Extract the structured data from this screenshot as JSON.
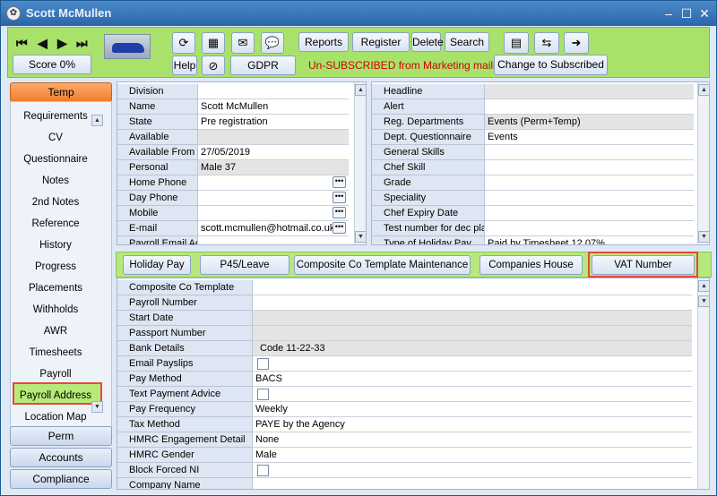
{
  "window": {
    "title": "Scott McMullen"
  },
  "toolbar": {
    "score": "Score 0%",
    "reports": "Reports",
    "register": "Register",
    "delete": "Delete",
    "search": "Search",
    "help": "Help",
    "gdpr": "GDPR",
    "unsubscribed": "Un-SUBSCRIBED from Marketing mailings",
    "change_sub": "Change to Subscribed"
  },
  "sidebar": {
    "temp": "Temp",
    "perm": "Perm",
    "accounts": "Accounts",
    "compliance": "Compliance",
    "items": [
      "Requirements",
      "CV",
      "Questionnaire",
      "Notes",
      "2nd Notes",
      "Reference",
      "History",
      "Progress",
      "Placements",
      "Withholds",
      "AWR",
      "Timesheets",
      "Payroll",
      "Payroll Address",
      "Location Map"
    ]
  },
  "left_panel": {
    "rows": [
      {
        "label": "Division",
        "value": ""
      },
      {
        "label": "Name",
        "value": "Scott McMullen"
      },
      {
        "label": "State",
        "value": "Pre registration"
      },
      {
        "label": "Available",
        "value": ""
      },
      {
        "label": "Available From",
        "value": "27/05/2019"
      },
      {
        "label": "Personal",
        "value": "Male 37"
      },
      {
        "label": "Home Phone",
        "value": ""
      },
      {
        "label": "Day Phone",
        "value": ""
      },
      {
        "label": "Mobile",
        "value": ""
      },
      {
        "label": "E-mail",
        "value": "scott.mcmullen@hotmail.co.uk"
      },
      {
        "label": "Payroll Email Adc",
        "value": ""
      }
    ]
  },
  "right_panel": {
    "rows": [
      {
        "label": "Headline",
        "value": ""
      },
      {
        "label": "Alert",
        "value": ""
      },
      {
        "label": "Reg. Departments",
        "value": "Events (Perm+Temp)"
      },
      {
        "label": "Dept. Questionnaire",
        "value": "Events"
      },
      {
        "label": "General Skills",
        "value": ""
      },
      {
        "label": "Chef Skill",
        "value": ""
      },
      {
        "label": "Grade",
        "value": ""
      },
      {
        "label": "Speciality",
        "value": ""
      },
      {
        "label": "Chef Expiry Date",
        "value": ""
      },
      {
        "label": "Test number for dec pla",
        "value": ""
      },
      {
        "label": "Type of Holiday Pay",
        "value": "Paid by Timesheet 12.07%"
      }
    ]
  },
  "tabs": [
    "Holiday Pay",
    "P45/Leave",
    "Composite Co Template Maintenance",
    "Companies House",
    "VAT Number"
  ],
  "payroll": {
    "rows": [
      {
        "label": "Composite Co Template",
        "value": ""
      },
      {
        "label": "Payroll Number",
        "value": ""
      },
      {
        "label": "Start Date",
        "value": ""
      },
      {
        "label": "Passport Number",
        "value": ""
      },
      {
        "label": "Bank Details",
        "value": "Code 11-22-33"
      },
      {
        "label": "Email Payslips",
        "value": ""
      },
      {
        "label": "Pay Method",
        "value": "BACS"
      },
      {
        "label": "Text Payment Advice",
        "value": ""
      },
      {
        "label": "Pay Frequency",
        "value": "Weekly"
      },
      {
        "label": "Tax Method",
        "value": "PAYE by the Agency"
      },
      {
        "label": "HMRC Engagement Detail",
        "value": "None"
      },
      {
        "label": "HMRC Gender",
        "value": "Male"
      },
      {
        "label": "Block Forced NI",
        "value": ""
      },
      {
        "label": "Company Name",
        "value": ""
      }
    ]
  }
}
